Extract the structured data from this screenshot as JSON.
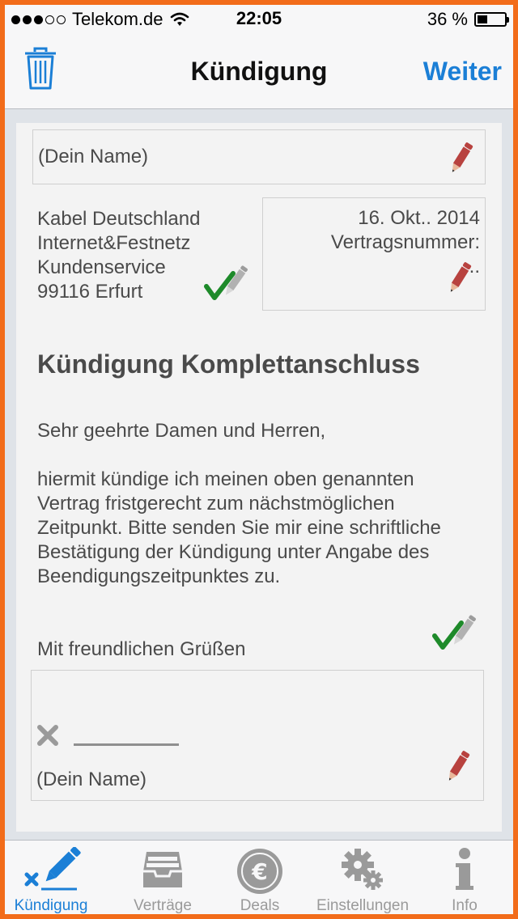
{
  "status": {
    "carrier": "Telekom.de",
    "time": "22:05",
    "battery": "36 %",
    "battery_level": 0.36
  },
  "nav": {
    "title": "Kündigung",
    "next_label": "Weiter"
  },
  "letter": {
    "sender_name": "(Dein Name)",
    "recipient": [
      "Kabel Deutschland",
      "Internet&Festnetz",
      "Kundenservice",
      "99116 Erfurt"
    ],
    "date": "16. Okt.. 2014",
    "contract_label": "Vertragsnummer:",
    "contract_value": "..",
    "subject": "Kündigung Komplettanschluss",
    "salutation": "Sehr geehrte Damen und Herren,",
    "body_lines": [
      "hiermit kündige ich meinen oben genannten",
      "Vertrag fristgerecht zum nächstmöglichen",
      "Zeitpunkt. Bitte senden Sie mir eine schriftliche",
      "Bestätigung  der Kündigung unter Angabe des",
      "Beendigungszeitpunktes zu."
    ],
    "closing": "Mit freundlichen Grüßen",
    "signature_name": "(Dein Name)"
  },
  "tabs": [
    {
      "label": "Kündigung",
      "icon": "cancel-pen-icon",
      "active": true
    },
    {
      "label": "Verträge",
      "icon": "inbox-tray-icon",
      "active": false
    },
    {
      "label": "Deals",
      "icon": "euro-coin-icon",
      "active": false
    },
    {
      "label": "Einstellungen",
      "icon": "gears-icon",
      "active": false
    },
    {
      "label": "Info",
      "icon": "info-icon",
      "active": false
    }
  ],
  "colors": {
    "accent": "#1b7fd6",
    "border": "#f26c1a",
    "edit_pencil": "#b8423f",
    "check": "#1e8a2a"
  }
}
